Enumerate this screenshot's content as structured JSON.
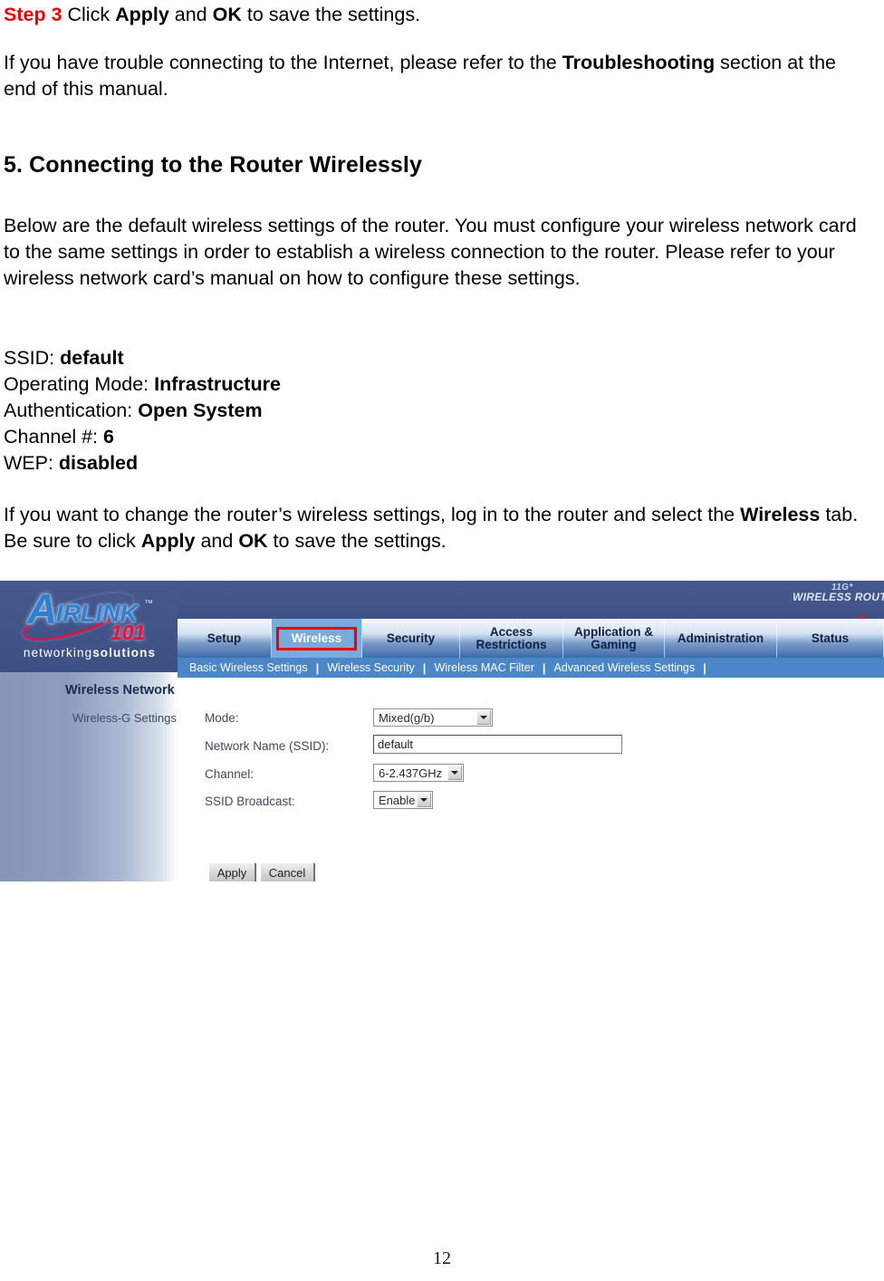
{
  "document": {
    "step3": {
      "label": "Step 3",
      "text": " Click ",
      "bold1": "Apply",
      "mid": " and ",
      "bold2": "OK",
      "tail": " to save the settings."
    },
    "trouble_paragraph": {
      "part1": "If you have trouble connecting to the Internet, please refer to the ",
      "bold": "Troubleshooting",
      "part2": " section at the end of this manual."
    },
    "section_heading": "5. Connecting to the Router Wirelessly",
    "intro_paragraph": "Below are the default wireless settings of the router. You must configure your wireless network card to the same settings in order to establish a wireless connection to the router. Please refer to your wireless network card’s manual on how to configure these settings.",
    "specs": [
      {
        "label": "SSID: ",
        "value": "default"
      },
      {
        "label": "Operating Mode: ",
        "value": "Infrastructure"
      },
      {
        "label": "Authentication: ",
        "value": "Open System"
      },
      {
        "label": "Channel #: ",
        "value": "6"
      },
      {
        "label": "WEP: ",
        "value": "disabled"
      }
    ],
    "closing_paragraph": {
      "part1": "If you want to change the router’s wireless settings, log in to the router and select the ",
      "bold1": "Wireless",
      "part2": " tab. Be sure to click ",
      "bold2": "Apply",
      "part3": " and ",
      "bold3": "OK",
      "part4": " to save the settings."
    },
    "page_number": "12"
  },
  "router_ui": {
    "brand": {
      "letter_a": "A",
      "name_rest": "IRLINK",
      "trademark": "™",
      "model": "101",
      "tagline_light": "networking",
      "tagline_bold": "solutions"
    },
    "product_logo": {
      "model": "11G*",
      "name": "WIRELESS ROUTER"
    },
    "tabs": [
      {
        "label": "Setup",
        "active": false
      },
      {
        "label": "Wireless",
        "active": true
      },
      {
        "label": "Security",
        "active": false
      },
      {
        "label": "Access Restrictions",
        "line1": "Access",
        "line2": "Restrictions",
        "active": false
      },
      {
        "label": "Application & Gaming",
        "line1": "Application &",
        "line2": "Gaming",
        "active": false
      },
      {
        "label": "Administration",
        "active": false
      },
      {
        "label": "Status",
        "active": false
      }
    ],
    "subtabs": [
      "Basic Wireless Settings",
      "Wireless Security",
      "Wireless MAC Filter",
      "Advanced Wireless Settings"
    ],
    "section_title": "Wireless Network",
    "section_subtitle": "Wireless-G Settings",
    "fields": [
      {
        "label": "Mode:",
        "value": "Mixed(g/b)",
        "control": "select"
      },
      {
        "label": "Network Name (SSID):",
        "value": "default",
        "control": "text"
      },
      {
        "label": "Channel:",
        "value": "6-2.437GHz",
        "control": "select"
      },
      {
        "label": "SSID Broadcast:",
        "value": "Enable",
        "control": "select"
      }
    ],
    "buttons": {
      "apply": "Apply",
      "cancel": "Cancel"
    },
    "colors": {
      "header_blue": "#3f5287",
      "subnav_blue": "#4b86c8",
      "active_tab_highlight": "#ee0000",
      "brand_blue": "#2f7fd0",
      "brand_red": "#e2123f"
    }
  }
}
